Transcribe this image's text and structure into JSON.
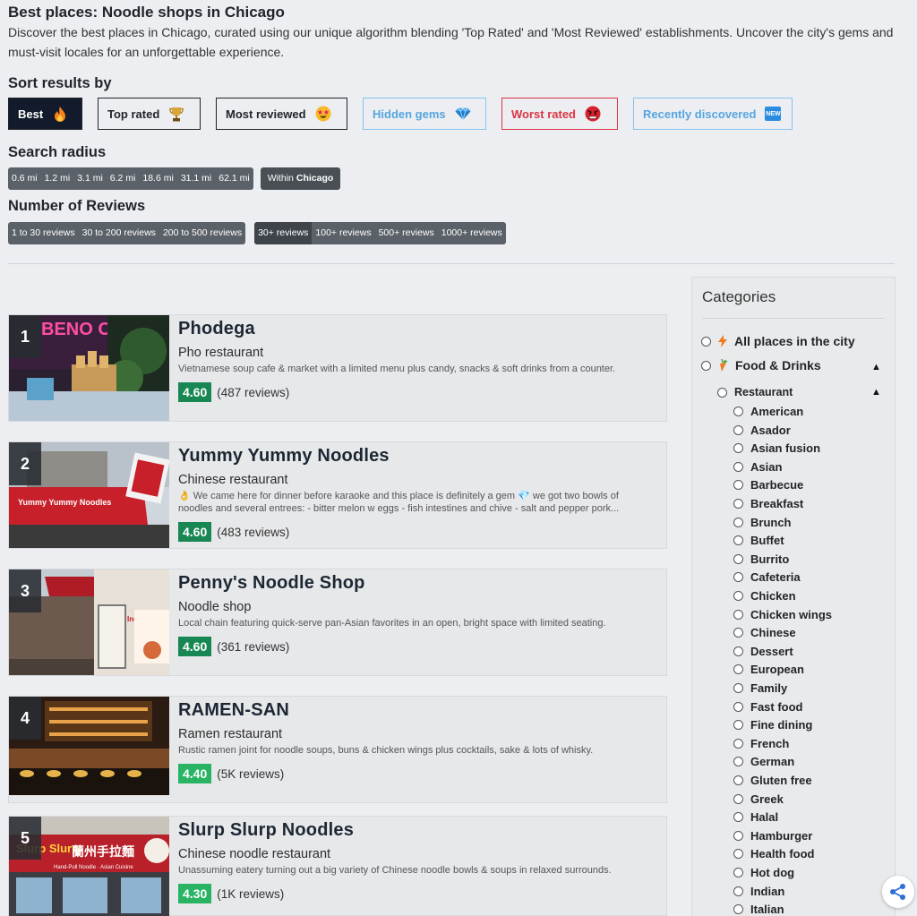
{
  "header": {
    "title": "Best places: Noodle shops in Chicago",
    "description": "Discover the best places in Chicago, curated using our unique algorithm blending 'Top Rated' and 'Most Reviewed' establishments. Uncover the city's gems and must-visit locales for an unforgettable experience."
  },
  "sort": {
    "heading": "Sort results by",
    "buttons": [
      {
        "label": "Best",
        "icon": "flame-icon"
      },
      {
        "label": "Top rated",
        "icon": "trophy-icon"
      },
      {
        "label": "Most reviewed",
        "icon": "star-struck-icon"
      },
      {
        "label": "Hidden gems",
        "icon": "gem-icon"
      },
      {
        "label": "Worst rated",
        "icon": "angry-face-icon"
      },
      {
        "label": "Recently discovered",
        "icon": "new-icon",
        "icon_text": "NEW"
      }
    ]
  },
  "radius": {
    "heading": "Search radius",
    "options": [
      "0.6 mi",
      "1.2 mi",
      "3.1 mi",
      "6.2 mi",
      "18.6 mi",
      "31.1 mi",
      "62.1 mi"
    ],
    "within_prefix": "Within",
    "within_city": "Chicago"
  },
  "reviews_filter": {
    "heading": "Number of Reviews",
    "group1": [
      "1 to 30 reviews",
      "30 to 200 reviews",
      "200 to 500 reviews"
    ],
    "group2": [
      "30+ reviews",
      "100+ reviews",
      "500+ reviews",
      "1000+ reviews"
    ]
  },
  "results": [
    {
      "rank": "1",
      "name": "Phodega",
      "type": "Pho restaurant",
      "about": "Vietnamese soup cafe & market with a limited menu plus candy, snacks & soft drinks from a counter.",
      "rating": "4.60",
      "reviews": "(487 reviews)"
    },
    {
      "rank": "2",
      "name": "Yummy Yummy Noodles",
      "type": "Chinese restaurant",
      "about": "👌 We came here for dinner before karaoke and this place is definitely a gem 💎 we got two bowls of noodles and several entrees: - bitter melon w eggs - fish intestines and chive - salt and pepper pork...",
      "rating": "4.60",
      "reviews": "(483 reviews)"
    },
    {
      "rank": "3",
      "name": "Penny's Noodle Shop",
      "type": "Noodle shop",
      "about": "Local chain featuring quick-serve pan-Asian favorites in an open, bright space with limited seating.",
      "rating": "4.60",
      "reviews": "(361 reviews)"
    },
    {
      "rank": "4",
      "name": "RAMEN-SAN",
      "type": "Ramen restaurant",
      "about": "Rustic ramen joint for noodle soups, buns & chicken wings plus cocktails, sake & lots of whisky.",
      "rating": "4.40",
      "reviews": "(5K reviews)"
    },
    {
      "rank": "5",
      "name": "Slurp Slurp Noodles",
      "type": "Chinese noodle restaurant",
      "about": "Unassuming eatery turning out a big variety of Chinese noodle bowls & soups in relaxed surrounds.",
      "rating": "4.30",
      "reviews": "(1K reviews)"
    }
  ],
  "image_text": {
    "phodega_sign": "BENO OODS",
    "yummy_awning": "Yummy Yummy Noodles",
    "penny_window": "Ine in, er online ick up.",
    "slurp_sign": "Slurp Slurp",
    "slurp_chinese": "蘭州手拉麵",
    "slurp_sub": "Hand-Pull Noodle · Asian Cuisine"
  },
  "categories": {
    "heading": "Categories",
    "all_places": "All places in the city",
    "food_drinks": "Food & Drinks",
    "restaurant": "Restaurant",
    "items": [
      "American",
      "Asador",
      "Asian fusion",
      "Asian",
      "Barbecue",
      "Breakfast",
      "Brunch",
      "Buffet",
      "Burrito",
      "Cafeteria",
      "Chicken",
      "Chicken wings",
      "Chinese",
      "Dessert",
      "European",
      "Family",
      "Fast food",
      "Fine dining",
      "French",
      "German",
      "Gluten free",
      "Greek",
      "Halal",
      "Hamburger",
      "Health food",
      "Hot dog",
      "Indian",
      "Italian"
    ]
  },
  "colors": {
    "best_bg": "#121b2b",
    "rating_green": "#198754",
    "rating_light_green": "#28b463",
    "worst_red": "#dc3545",
    "gems_blue": "#56a5e0"
  }
}
